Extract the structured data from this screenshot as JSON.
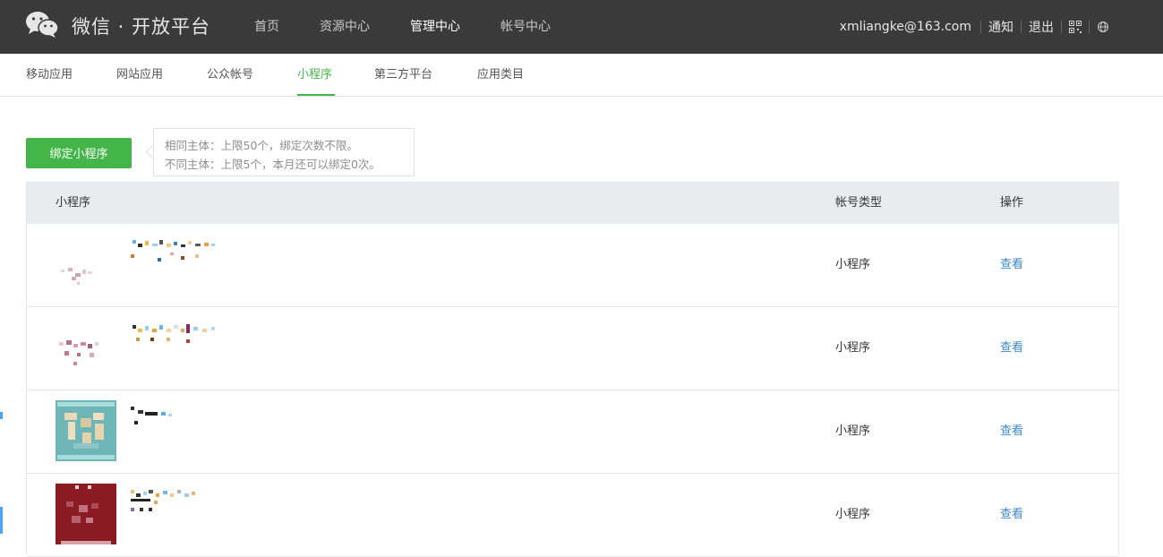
{
  "brand": {
    "title": "微信 · 开放平台"
  },
  "topnav": [
    {
      "label": "首页",
      "active": false
    },
    {
      "label": "资源中心",
      "active": false
    },
    {
      "label": "管理中心",
      "active": true
    },
    {
      "label": "帐号中心",
      "active": false
    }
  ],
  "topright": {
    "email": "xmliangke@163.com",
    "notify": "通知",
    "logout": "退出"
  },
  "subnav": [
    {
      "label": "移动应用"
    },
    {
      "label": "网站应用"
    },
    {
      "label": "公众帐号"
    },
    {
      "label": "小程序",
      "active": true
    },
    {
      "label": "第三方平台"
    },
    {
      "label": "应用类目"
    }
  ],
  "bind_button": "绑定小程序",
  "tip": {
    "line1": "相同主体：上限50个，绑定次数不限。",
    "line2": "不同主体：上限5个，本月还可以绑定0次。"
  },
  "table": {
    "headers": {
      "name": "小程序",
      "type": "帐号类型",
      "action": "操作"
    },
    "rows": [
      {
        "type": "小程序",
        "action": "查看"
      },
      {
        "type": "小程序",
        "action": "查看"
      },
      {
        "type": "小程序",
        "action": "查看"
      },
      {
        "type": "小程序",
        "action": "查看"
      }
    ]
  },
  "colors": {
    "accent": "#44b549",
    "link": "#3b89c9",
    "topbar": "#3a3a3a"
  }
}
